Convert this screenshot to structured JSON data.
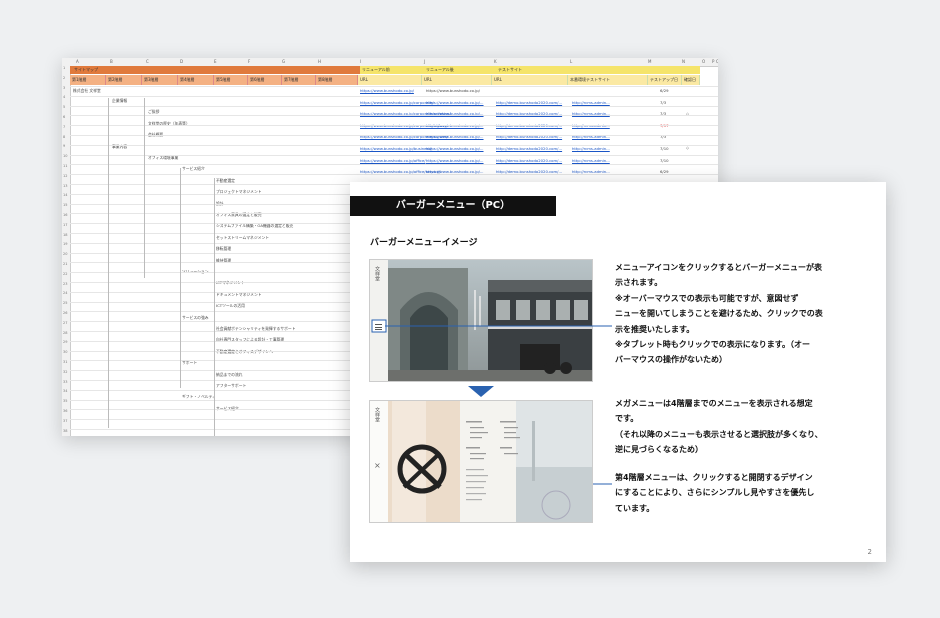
{
  "spreadsheet": {
    "col_letters": [
      "A",
      "B",
      "C",
      "D",
      "E",
      "F",
      "G",
      "H",
      "I",
      "J",
      "K",
      "L",
      "M",
      "N",
      "O",
      "P",
      "Q",
      "AK"
    ],
    "band_site_map": "サイトマップ",
    "band_renewal_before": "リニューアル前",
    "band_renewal_after": "リニューアル後",
    "band_test_site": "テストサイト",
    "headers": [
      "第1階層",
      "第2階層",
      "第3階層",
      "第4階層",
      "第5階層",
      "第6階層",
      "第7階層",
      "第8階層",
      "URL",
      "URL",
      "URL",
      "本番環境テストサイト",
      "テストアップ日",
      "確認日"
    ],
    "company": "株式会社 文祥堂",
    "tree_items": [
      "企業情報",
      "ご挨拶",
      "文祥堂の歴史（年表等）",
      "会社概要",
      "事業内容",
      "オフィス環境事業",
      "サービス紹介",
      "不動産選定",
      "プロジェクトマネジメント",
      "設計",
      "オフィス家具の選定と販売",
      "システムファイル構築・OA機器の選定と販売",
      "セットストリームマネジメント",
      "移転管理",
      "維持管理",
      "ソリューション",
      "ICTマネジメント",
      "ドキュメントマネジメント",
      "ICTツールの活用",
      "サービスの強み",
      "社会貢献ポテンシャリティを発揮するサポート",
      "自社専門スタッフによる設計・工事管理",
      "不動産選定とオフィスデザインへ",
      "サポート",
      "納品までの流れ",
      "アフターサポート",
      "ギフト・ノベルティ",
      "サービス紹介"
    ],
    "urls_before": [
      "https://www.bunshodo.co.jp/",
      "https://www.bunshodo.co.jp/corporate/",
      "https://www.bunshodo.co.jp/corporate/greeting/",
      "https://www.bunshodo.co.jp/corporate/history/",
      "https://www.bunshodo.co.jp/corporate/outline/",
      "https://www.bunshodo.co.jp/business/",
      "https://www.bunshodo.co.jp/office/",
      "https://www.bunshodo.co.jp/office/service/"
    ],
    "url_after_top": "https://www.bunshodo.co.jp/",
    "dates": [
      "6/29",
      "7/3",
      "7/3",
      "7/17",
      "7/3",
      "7/10",
      "7/10",
      "6/29"
    ],
    "checks": [
      "◇",
      "◇"
    ]
  },
  "slide": {
    "title": "バーガーメニュー（PC）",
    "subtitle": "バーガーメニューイメージ",
    "para1": [
      "メニューアイコンをクリックするとバーガーメニューが表",
      "示されます。",
      "※オーバーマウスでの表示も可能ですが、意図せず",
      "ニューを開いてしまうことを避けるため、クリックでの表",
      "示を推奨いたします。",
      "※タブレット時もクリックでの表示になります。（オー",
      "バーマウスの操作がないため）"
    ],
    "para2": [
      "メガメニューは4階層までのメニューを表示される想定",
      "です。",
      "（それ以降のメニューも表示させると選択肢が多くなり、",
      "逆に見づらくなるため）"
    ],
    "para3": [
      "第4階層メニューは、クリックすると開閉するデザイン",
      "にすることにより、さらにシンプルし見やすさを優先し",
      "ています。"
    ],
    "logo_text": "文祥堂",
    "page_number": "2",
    "colors": {
      "accent_blue": "#2a62b0",
      "title_bg": "#111111",
      "sheet_orange": "#e07a3c",
      "sheet_yellow": "#f5e46a"
    }
  }
}
